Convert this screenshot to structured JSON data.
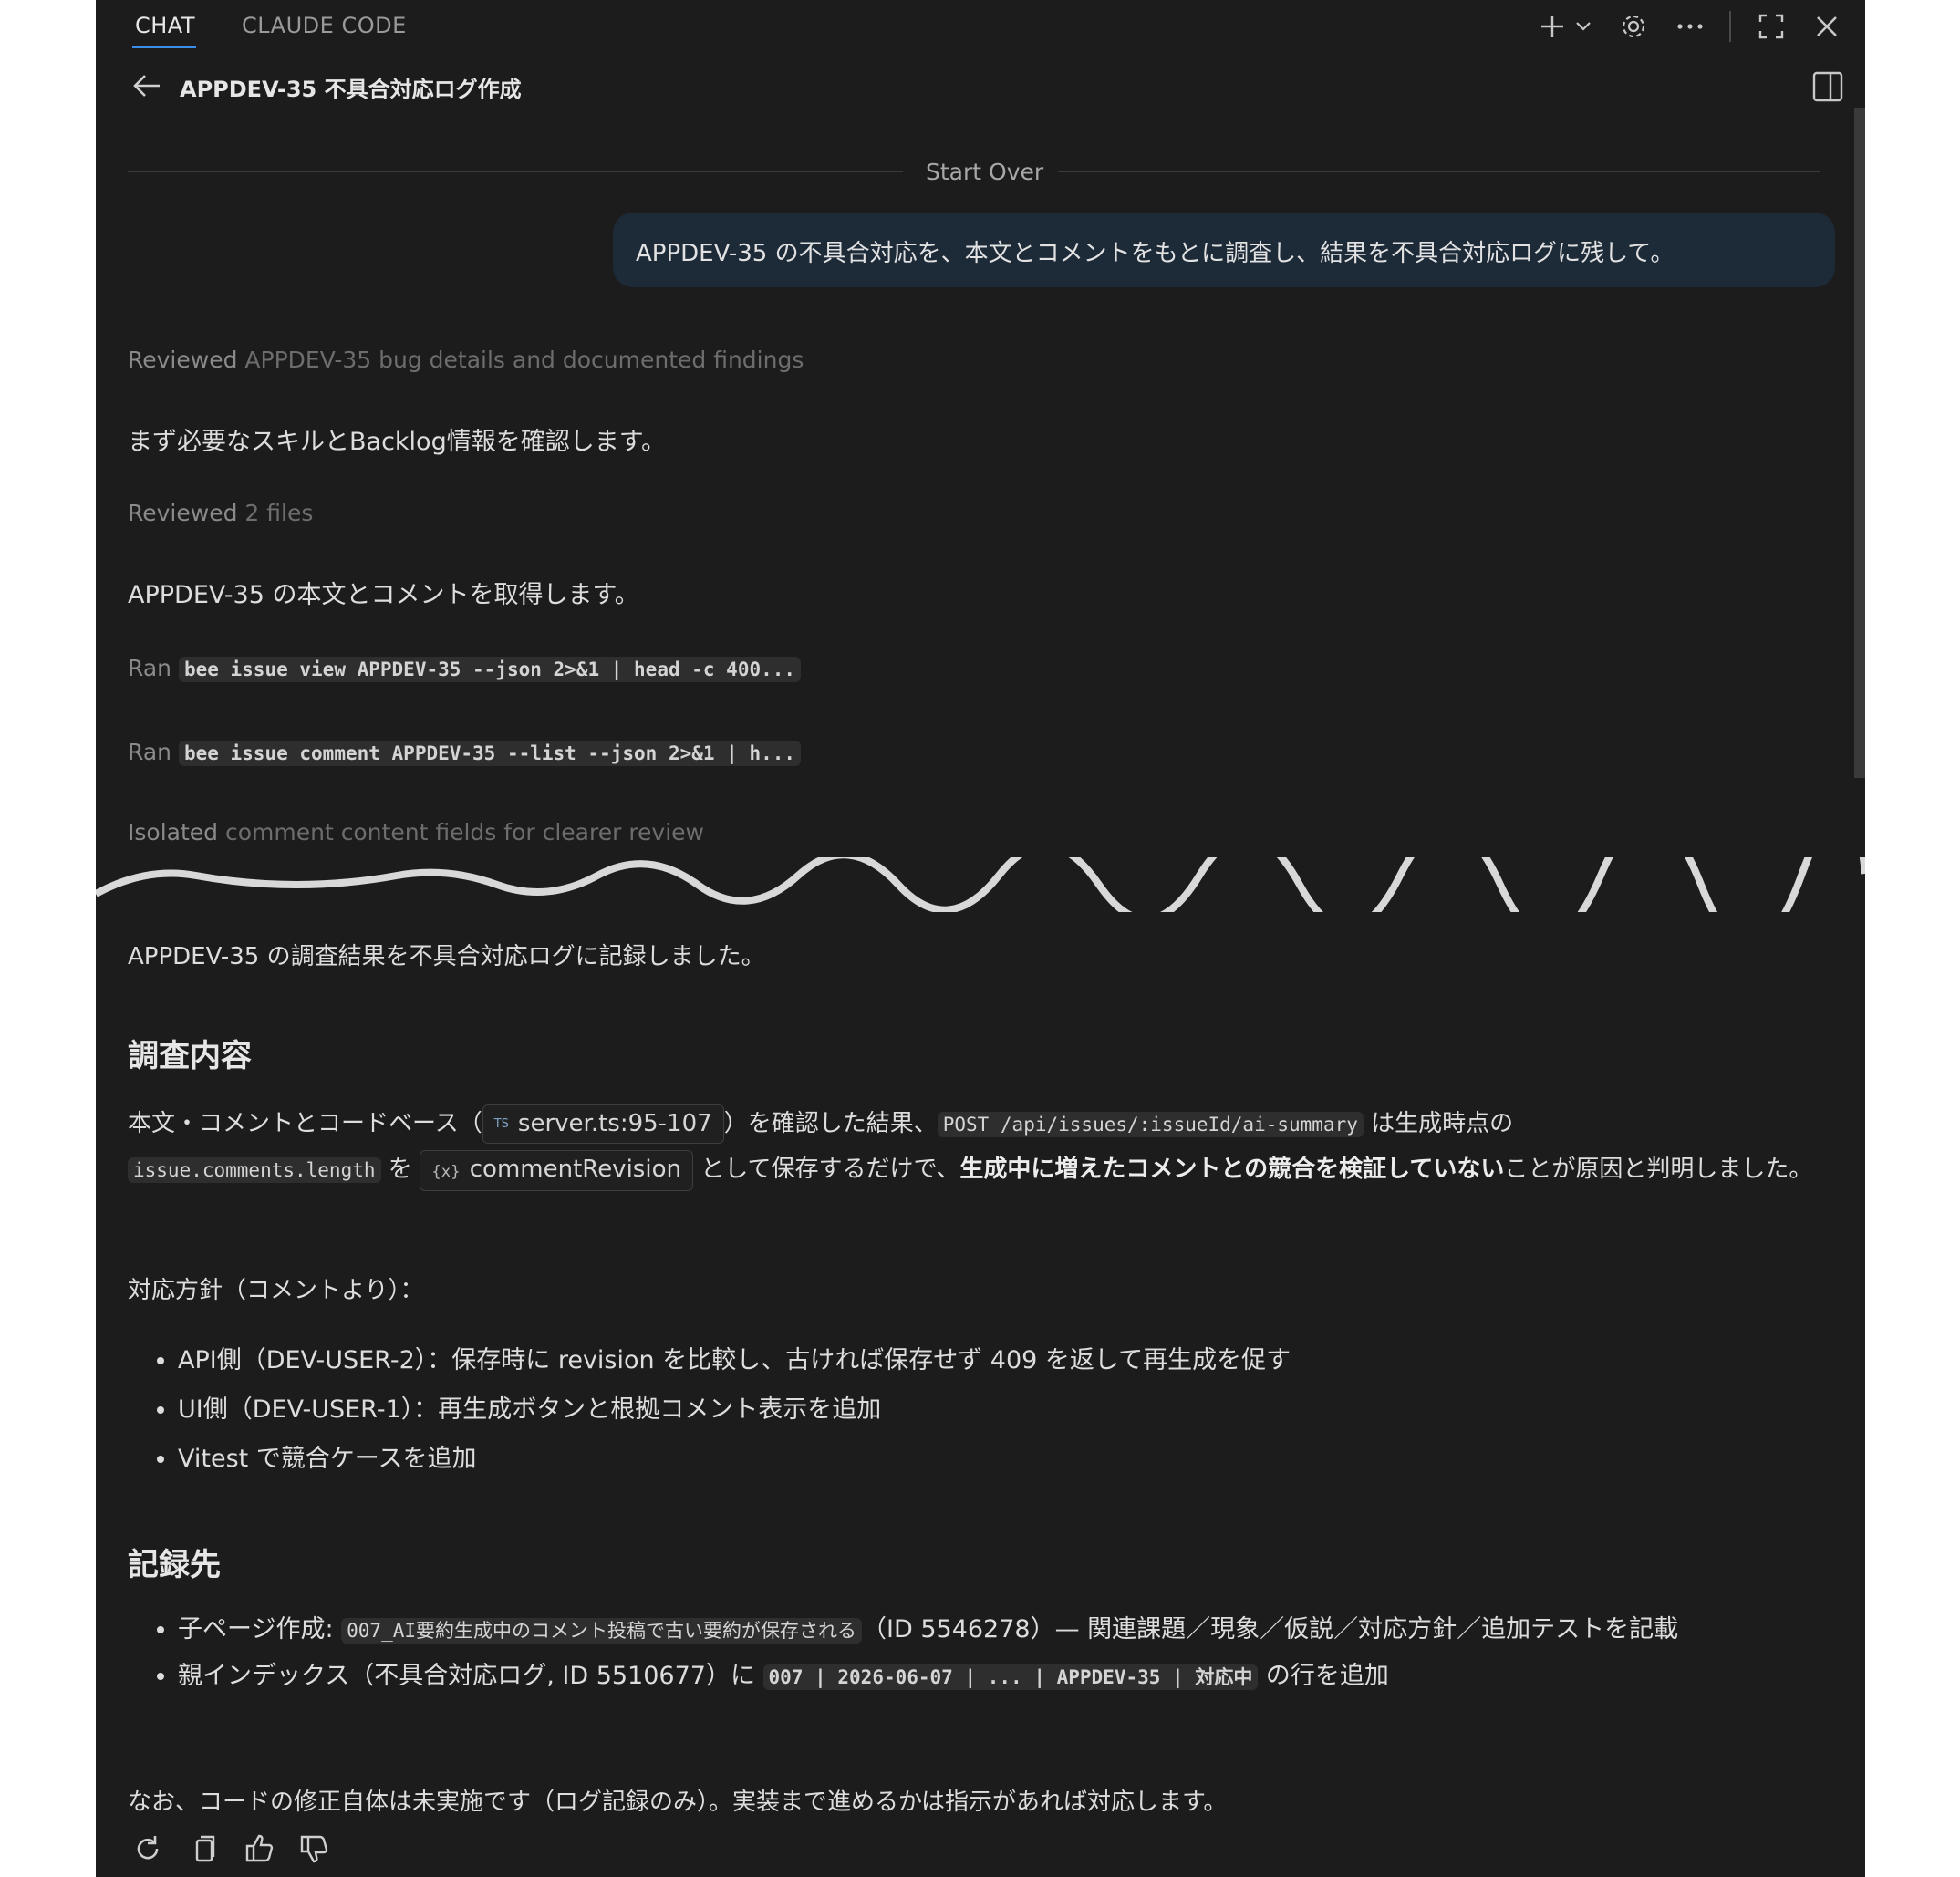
{
  "tabs": {
    "chat": "CHAT",
    "claude_code": "CLAUDE CODE"
  },
  "header": {
    "title": "APPDEV-35 不具合対応ログ作成"
  },
  "start_over": "Start Over",
  "user_message": "APPDEV-35 の不具合対応を、本文とコメントをもとに調査し、結果を不具合対応ログに残して。",
  "steps": {
    "reviewed1_verb": "Reviewed",
    "reviewed1_detail": "APPDEV-35 bug details and documented findings",
    "msg1": "まず必要なスキルとBacklog情報を確認します。",
    "reviewed2_verb": "Reviewed",
    "reviewed2_detail": "2 files",
    "msg2": "APPDEV-35 の本文とコメントを取得します。",
    "ran_label": "Ran",
    "cmd1": "bee issue view APPDEV-35 --json 2>&1 | head -c 400...",
    "cmd2": "bee issue comment APPDEV-35 --list --json 2>&1 | h...",
    "isolated_verb": "Isolated",
    "isolated_detail": "comment content fields for clearer review"
  },
  "result": {
    "summary": "APPDEV-35 の調査結果を不具合対応ログに記録しました。",
    "h_investigation": "調査内容",
    "p1_a": "本文・コメントとコードベース（",
    "chip_file_icon": "TS",
    "chip_file": "server.ts:95-107",
    "p1_b": "）を確認した結果、",
    "code_api": "POST /api/issues/:issueId/ai-summary",
    "p1_c": "は生成時点の",
    "code_len": "issue.comments.length",
    "p1_d": "を",
    "chip_var_icon": "{x}",
    "chip_var": "commentRevision",
    "p1_e": "として保存するだけで、",
    "p1_bold": "生成中に増えたコメントとの競合を検証していない",
    "p1_f": "ことが原因と判明しました。",
    "policy_label": "対応方針（コメントより）：",
    "policy_items": [
      "API側（DEV-USER-2）：保存時に revision を比較し、古ければ保存せず 409 を返して再生成を促す",
      "UI側（DEV-USER-1）：再生成ボタンと根拠コメント表示を追加",
      "Vitest で競合ケースを追加"
    ],
    "h_record": "記録先",
    "rec1_a": "子ページ作成: ",
    "rec1_code": "007_AI要約生成中のコメント投稿で古い要約が保存される",
    "rec1_b": "（ID 5546278）— 関連課題／現象／仮説／対応方針／追加テストを記載",
    "rec2_a": "親インデックス（不具合対応ログ, ID 5510677）に ",
    "rec2_code": "007 | 2026-06-07 | ... | APPDEV-35 | 対応中",
    "rec2_b": " の行を追加",
    "footer_note": "なお、コードの修正自体は未実施です（ログ記録のみ）。実装まで進めるかは指示があれば対応します。"
  },
  "colors": {
    "panel_bg": "#1c1c1c",
    "user_bubble_bg": "#1d2a38",
    "tab_underline": "#3b8eea",
    "code_bg": "#2e2e2e"
  },
  "icons": [
    "plus-icon",
    "chevron-down-icon",
    "gear-icon",
    "more-icon",
    "maximize-icon",
    "close-icon",
    "back-arrow-icon",
    "split-panel-icon",
    "retry-icon",
    "copy-icon",
    "thumbs-up-icon",
    "thumbs-down-icon"
  ]
}
